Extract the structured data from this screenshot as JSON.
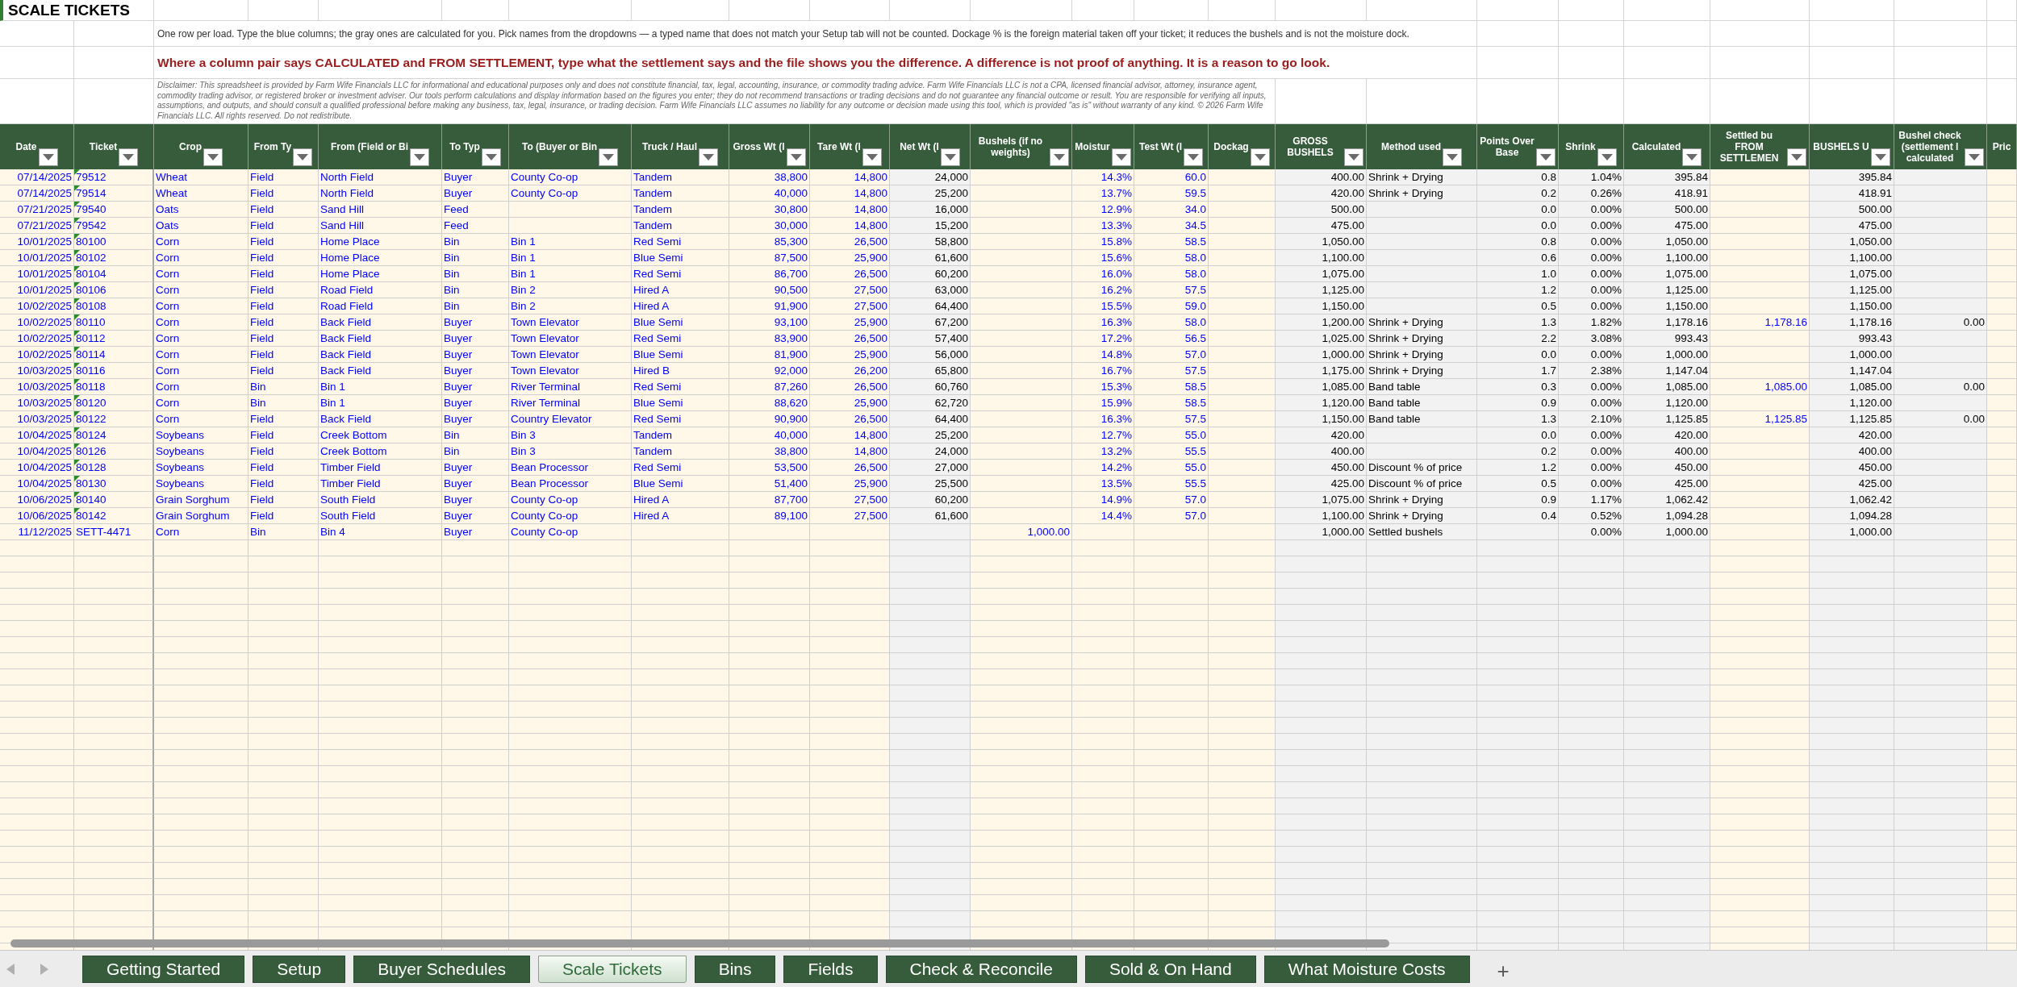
{
  "sheet_title": "SCALE TICKETS",
  "instructions": "One row per load. Type the blue columns; the gray ones are calculated for you. Pick names from the dropdowns — a typed name that does not match your Setup tab will not be counted. Dockage % is the foreign material taken off your ticket; it reduces the bushels and is not the moisture dock.",
  "warning": "Where a column pair says CALCULATED and FROM SETTLEMENT, type what the settlement says and the file shows you the difference. A difference is not proof of anything. It is a reason to go look.",
  "disclaimer": "Disclaimer: This spreadsheet is provided by Farm Wife Financials LLC for informational and educational purposes only and does not constitute financial, tax, legal, accounting, insurance, or commodity trading advice. Farm Wife Financials LLC is not a CPA, licensed financial advisor, attorney, insurance agent, commodity trading advisor, or registered broker or investment adviser. Our tools perform calculations and display information based on the figures you enter; they do not recommend transactions or trading decisions and do not guarantee any financial outcome or result. You are responsible for verifying all inputs, assumptions, and outputs, and should consult a qualified professional before making any business, tax, legal, insurance, or trading decision. Farm Wife Financials LLC assumes no liability for any outcome or decision made using this tool, which is provided \"as is\" without warranty of any kind. © 2026 Farm Wife Financials LLC. All rights reserved. Do not redistribute.",
  "columns": [
    {
      "label": "Date",
      "kind": "input",
      "filter": true
    },
    {
      "label": "Ticket",
      "kind": "input",
      "filter": true
    },
    {
      "label": "Crop",
      "kind": "input",
      "filter": true
    },
    {
      "label": "From Ty",
      "kind": "input",
      "filter": true
    },
    {
      "label": "From (Field or Bi",
      "kind": "input",
      "filter": true
    },
    {
      "label": "To Typ",
      "kind": "input",
      "filter": true
    },
    {
      "label": "To (Buyer or Bin",
      "kind": "input",
      "filter": true
    },
    {
      "label": "Truck / Haul",
      "kind": "input",
      "filter": true
    },
    {
      "label": "Gross Wt (l",
      "kind": "input",
      "filter": true
    },
    {
      "label": "Tare Wt (l",
      "kind": "input",
      "filter": true
    },
    {
      "label": "Net Wt (l",
      "kind": "calculated",
      "filter": true
    },
    {
      "label": "Bushels (if no weights)",
      "kind": "input",
      "filter": true
    },
    {
      "label": "Moistur",
      "kind": "input",
      "filter": true
    },
    {
      "label": "Test Wt (l",
      "kind": "input",
      "filter": true
    },
    {
      "label": "Dockag",
      "kind": "input",
      "filter": true
    },
    {
      "label": "GROSS BUSHELS",
      "kind": "calculated",
      "filter": true
    },
    {
      "label": "Method used",
      "kind": "calculated",
      "filter": true
    },
    {
      "label": "Points Over Base",
      "kind": "calculated",
      "filter": true
    },
    {
      "label": "Shrink",
      "kind": "calculated",
      "filter": true
    },
    {
      "label": "Calculated",
      "kind": "calculated",
      "filter": true
    },
    {
      "label": "Settled bu FROM SETTLEMEN",
      "kind": "input",
      "filter": true
    },
    {
      "label": "BUSHELS U",
      "kind": "calculated",
      "filter": true
    },
    {
      "label": "Bushel check (settlement l calculated",
      "kind": "calculated",
      "filter": true
    },
    {
      "label": "Pric",
      "kind": "input",
      "filter": false
    }
  ],
  "rows": [
    {
      "note_flag": true,
      "cells": [
        "07/14/2025",
        "79512",
        "Wheat",
        "Field",
        "North Field",
        "Buyer",
        "County Co-op",
        "Tandem",
        "38,800",
        "14,800",
        "24,000",
        null,
        "14.3%",
        "60.0",
        null,
        "400.00",
        "Shrink + Drying",
        "0.8",
        "1.04%",
        "395.84",
        null,
        "395.84",
        null
      ]
    },
    {
      "note_flag": true,
      "cells": [
        "07/14/2025",
        "79514",
        "Wheat",
        "Field",
        "North Field",
        "Buyer",
        "County Co-op",
        "Tandem",
        "40,000",
        "14,800",
        "25,200",
        null,
        "13.7%",
        "59.5",
        null,
        "420.00",
        "Shrink + Drying",
        "0.2",
        "0.26%",
        "418.91",
        null,
        "418.91",
        null
      ]
    },
    {
      "note_flag": true,
      "cells": [
        "07/21/2025",
        "79540",
        "Oats",
        "Field",
        "Sand Hill",
        "Feed",
        null,
        "Tandem",
        "30,800",
        "14,800",
        "16,000",
        null,
        "12.9%",
        "34.0",
        null,
        "500.00",
        null,
        "0.0",
        "0.00%",
        "500.00",
        null,
        "500.00",
        null
      ]
    },
    {
      "note_flag": true,
      "cells": [
        "07/21/2025",
        "79542",
        "Oats",
        "Field",
        "Sand Hill",
        "Feed",
        null,
        "Tandem",
        "30,000",
        "14,800",
        "15,200",
        null,
        "13.3%",
        "34.5",
        null,
        "475.00",
        null,
        "0.0",
        "0.00%",
        "475.00",
        null,
        "475.00",
        null
      ]
    },
    {
      "note_flag": true,
      "cells": [
        "10/01/2025",
        "80100",
        "Corn",
        "Field",
        "Home Place",
        "Bin",
        "Bin 1",
        "Red Semi",
        "85,300",
        "26,500",
        "58,800",
        null,
        "15.8%",
        "58.5",
        null,
        "1,050.00",
        null,
        "0.8",
        "0.00%",
        "1,050.00",
        null,
        "1,050.00",
        null
      ]
    },
    {
      "note_flag": true,
      "cells": [
        "10/01/2025",
        "80102",
        "Corn",
        "Field",
        "Home Place",
        "Bin",
        "Bin 1",
        "Blue Semi",
        "87,500",
        "25,900",
        "61,600",
        null,
        "15.6%",
        "58.0",
        null,
        "1,100.00",
        null,
        "0.6",
        "0.00%",
        "1,100.00",
        null,
        "1,100.00",
        null
      ]
    },
    {
      "note_flag": true,
      "cells": [
        "10/01/2025",
        "80104",
        "Corn",
        "Field",
        "Home Place",
        "Bin",
        "Bin 1",
        "Red Semi",
        "86,700",
        "26,500",
        "60,200",
        null,
        "16.0%",
        "58.0",
        null,
        "1,075.00",
        null,
        "1.0",
        "0.00%",
        "1,075.00",
        null,
        "1,075.00",
        null
      ]
    },
    {
      "note_flag": true,
      "cells": [
        "10/01/2025",
        "80106",
        "Corn",
        "Field",
        "Road Field",
        "Bin",
        "Bin 2",
        "Hired A",
        "90,500",
        "27,500",
        "63,000",
        null,
        "16.2%",
        "57.5",
        null,
        "1,125.00",
        null,
        "1.2",
        "0.00%",
        "1,125.00",
        null,
        "1,125.00",
        null
      ]
    },
    {
      "note_flag": true,
      "cells": [
        "10/02/2025",
        "80108",
        "Corn",
        "Field",
        "Road Field",
        "Bin",
        "Bin 2",
        "Hired A",
        "91,900",
        "27,500",
        "64,400",
        null,
        "15.5%",
        "59.0",
        null,
        "1,150.00",
        null,
        "0.5",
        "0.00%",
        "1,150.00",
        null,
        "1,150.00",
        null
      ]
    },
    {
      "note_flag": true,
      "cells": [
        "10/02/2025",
        "80110",
        "Corn",
        "Field",
        "Back Field",
        "Buyer",
        "Town Elevator",
        "Blue Semi",
        "93,100",
        "25,900",
        "67,200",
        null,
        "16.3%",
        "58.0",
        null,
        "1,200.00",
        "Shrink + Drying",
        "1.3",
        "1.82%",
        "1,178.16",
        "1,178.16",
        "1,178.16",
        "0.00"
      ]
    },
    {
      "note_flag": true,
      "cells": [
        "10/02/2025",
        "80112",
        "Corn",
        "Field",
        "Back Field",
        "Buyer",
        "Town Elevator",
        "Red Semi",
        "83,900",
        "26,500",
        "57,400",
        null,
        "17.2%",
        "56.5",
        null,
        "1,025.00",
        "Shrink + Drying",
        "2.2",
        "3.08%",
        "993.43",
        null,
        "993.43",
        null
      ]
    },
    {
      "note_flag": true,
      "cells": [
        "10/02/2025",
        "80114",
        "Corn",
        "Field",
        "Back Field",
        "Buyer",
        "Town Elevator",
        "Blue Semi",
        "81,900",
        "25,900",
        "56,000",
        null,
        "14.8%",
        "57.0",
        null,
        "1,000.00",
        "Shrink + Drying",
        "0.0",
        "0.00%",
        "1,000.00",
        null,
        "1,000.00",
        null
      ]
    },
    {
      "note_flag": true,
      "cells": [
        "10/03/2025",
        "80116",
        "Corn",
        "Field",
        "Back Field",
        "Buyer",
        "Town Elevator",
        "Hired B",
        "92,000",
        "26,200",
        "65,800",
        null,
        "16.7%",
        "57.5",
        null,
        "1,175.00",
        "Shrink + Drying",
        "1.7",
        "2.38%",
        "1,147.04",
        null,
        "1,147.04",
        null
      ]
    },
    {
      "note_flag": true,
      "cells": [
        "10/03/2025",
        "80118",
        "Corn",
        "Bin",
        "Bin 1",
        "Buyer",
        "River Terminal",
        "Red Semi",
        "87,260",
        "26,500",
        "60,760",
        null,
        "15.3%",
        "58.5",
        null,
        "1,085.00",
        "Band table",
        "0.3",
        "0.00%",
        "1,085.00",
        "1,085.00",
        "1,085.00",
        "0.00"
      ]
    },
    {
      "note_flag": true,
      "cells": [
        "10/03/2025",
        "80120",
        "Corn",
        "Bin",
        "Bin 1",
        "Buyer",
        "River Terminal",
        "Blue Semi",
        "88,620",
        "25,900",
        "62,720",
        null,
        "15.9%",
        "58.5",
        null,
        "1,120.00",
        "Band table",
        "0.9",
        "0.00%",
        "1,120.00",
        null,
        "1,120.00",
        null
      ]
    },
    {
      "note_flag": true,
      "cells": [
        "10/03/2025",
        "80122",
        "Corn",
        "Field",
        "Back Field",
        "Buyer",
        "Country Elevator",
        "Red Semi",
        "90,900",
        "26,500",
        "64,400",
        null,
        "16.3%",
        "57.5",
        null,
        "1,150.00",
        "Band table",
        "1.3",
        "2.10%",
        "1,125.85",
        "1,125.85",
        "1,125.85",
        "0.00"
      ]
    },
    {
      "note_flag": true,
      "cells": [
        "10/04/2025",
        "80124",
        "Soybeans",
        "Field",
        "Creek Bottom",
        "Bin",
        "Bin 3",
        "Tandem",
        "40,000",
        "14,800",
        "25,200",
        null,
        "12.7%",
        "55.0",
        null,
        "420.00",
        null,
        "0.0",
        "0.00%",
        "420.00",
        null,
        "420.00",
        null
      ]
    },
    {
      "note_flag": true,
      "cells": [
        "10/04/2025",
        "80126",
        "Soybeans",
        "Field",
        "Creek Bottom",
        "Bin",
        "Bin 3",
        "Tandem",
        "38,800",
        "14,800",
        "24,000",
        null,
        "13.2%",
        "55.5",
        null,
        "400.00",
        null,
        "0.2",
        "0.00%",
        "400.00",
        null,
        "400.00",
        null
      ]
    },
    {
      "note_flag": true,
      "cells": [
        "10/04/2025",
        "80128",
        "Soybeans",
        "Field",
        "Timber Field",
        "Buyer",
        "Bean Processor",
        "Red Semi",
        "53,500",
        "26,500",
        "27,000",
        null,
        "14.2%",
        "55.0",
        null,
        "450.00",
        "Discount % of price",
        "1.2",
        "0.00%",
        "450.00",
        null,
        "450.00",
        null
      ]
    },
    {
      "note_flag": true,
      "cells": [
        "10/04/2025",
        "80130",
        "Soybeans",
        "Field",
        "Timber Field",
        "Buyer",
        "Bean Processor",
        "Blue Semi",
        "51,400",
        "25,900",
        "25,500",
        null,
        "13.5%",
        "55.5",
        null,
        "425.00",
        "Discount % of price",
        "0.5",
        "0.00%",
        "425.00",
        null,
        "425.00",
        null
      ]
    },
    {
      "note_flag": true,
      "cells": [
        "10/06/2025",
        "80140",
        "Grain Sorghum",
        "Field",
        "South Field",
        "Buyer",
        "County Co-op",
        "Hired A",
        "87,700",
        "27,500",
        "60,200",
        null,
        "14.9%",
        "57.0",
        null,
        "1,075.00",
        "Shrink + Drying",
        "0.9",
        "1.17%",
        "1,062.42",
        null,
        "1,062.42",
        null
      ]
    },
    {
      "note_flag": true,
      "cells": [
        "10/06/2025",
        "80142",
        "Grain Sorghum",
        "Field",
        "South Field",
        "Buyer",
        "County Co-op",
        "Hired A",
        "89,100",
        "27,500",
        "61,600",
        null,
        "14.4%",
        "57.0",
        null,
        "1,100.00",
        "Shrink + Drying",
        "0.4",
        "0.52%",
        "1,094.28",
        null,
        "1,094.28",
        null
      ]
    },
    {
      "note_flag": false,
      "cells": [
        "11/12/2025",
        "SETT-4471",
        "Corn",
        "Bin",
        "Bin 4",
        "Buyer",
        "County Co-op",
        null,
        null,
        null,
        null,
        "1,000.00",
        null,
        null,
        null,
        "1,000.00",
        "Settled bushels",
        null,
        "0.00%",
        "1,000.00",
        null,
        "1,000.00",
        null
      ]
    }
  ],
  "tabs": [
    {
      "label": "Getting Started",
      "selected": false
    },
    {
      "label": "Setup",
      "selected": false
    },
    {
      "label": "Buyer Schedules",
      "selected": false
    },
    {
      "label": "Scale Tickets",
      "selected": true
    },
    {
      "label": "Bins",
      "selected": false
    },
    {
      "label": "Fields",
      "selected": false
    },
    {
      "label": "Check & Reconcile",
      "selected": false
    },
    {
      "label": "Sold & On Hand",
      "selected": false
    },
    {
      "label": "What Moisture Costs",
      "selected": false
    }
  ],
  "add_tab_button": "+"
}
